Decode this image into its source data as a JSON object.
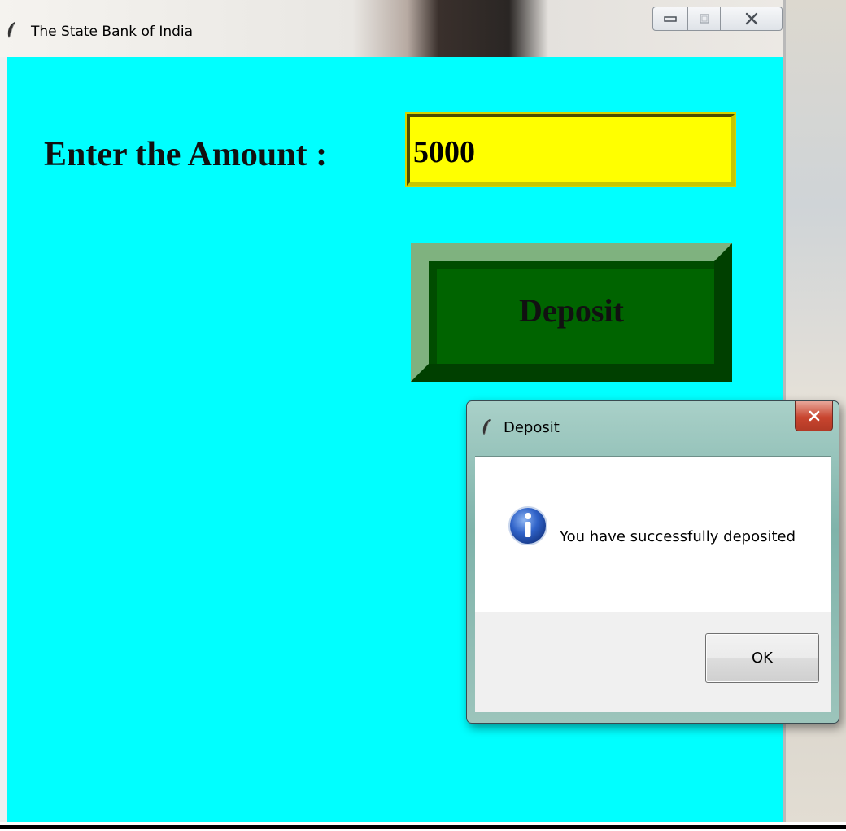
{
  "window": {
    "title": "The State Bank of India",
    "icon": "feather-icon"
  },
  "form": {
    "amount_label": "Enter the Amount  :",
    "amount_value": "5000",
    "deposit_label": "Deposit"
  },
  "dialog": {
    "title": "Deposit",
    "icon": "info-icon",
    "message": "You have successfully deposited",
    "ok_label": "OK"
  },
  "colors": {
    "client_background": "#00ffff",
    "amount_field": "#ffff00",
    "deposit_button": "#006400"
  }
}
